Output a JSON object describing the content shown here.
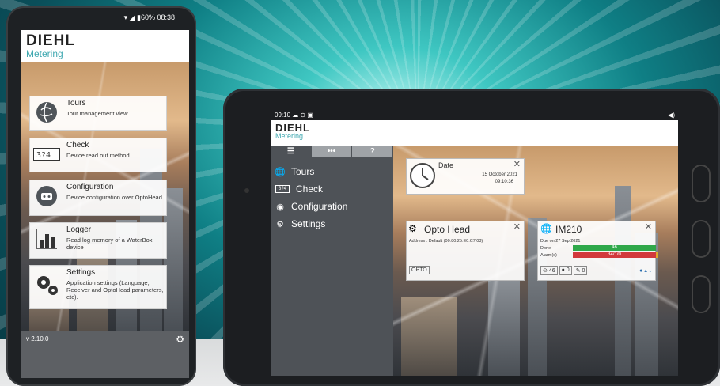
{
  "phone": {
    "status": "▾ ◢ ▮60% 08:38",
    "logo": {
      "brand": "DIEHL",
      "sub": "Metering"
    },
    "menu": [
      {
        "title": "Tours",
        "desc": "Tour management view."
      },
      {
        "title": "Check",
        "desc": "Device read out method."
      },
      {
        "title": "Configuration",
        "desc": "Device configuration over OptoHead."
      },
      {
        "title": "Logger",
        "desc": "Read log memory of a WaterBox device"
      },
      {
        "title": "Settings",
        "desc": "Application settings (Language, Receiver and OptoHead parameters, etc)."
      }
    ],
    "version": "v 2.10.0"
  },
  "tablet": {
    "status": {
      "time": "09:10 ☁ ⊙ ▣",
      "right": "◀)"
    },
    "logo": {
      "brand": "DIEHL",
      "sub": "Metering"
    },
    "tabs": [
      "☰",
      "•••",
      "?"
    ],
    "nav": [
      "Tours",
      "Check",
      "Configuration",
      "Settings"
    ],
    "widgets": {
      "date": {
        "title": "Date",
        "date": "15 October 2021",
        "time": "09:10:36"
      },
      "opto": {
        "title": "Opto Head",
        "address": "Address : Default (00:80:25:E0:C7:03)",
        "button": "OPTO"
      },
      "im210": {
        "title": "IM210",
        "due": "Due on 27 Sep 2021",
        "done_label": "Done",
        "done_value": "46",
        "alarms_label": "Alarm(s)",
        "alarms_value": "34/1/0",
        "counters": [
          "⊙ 46",
          "● 0",
          "✎ 0"
        ],
        "status_icons": "● ▴ ◒"
      }
    }
  }
}
